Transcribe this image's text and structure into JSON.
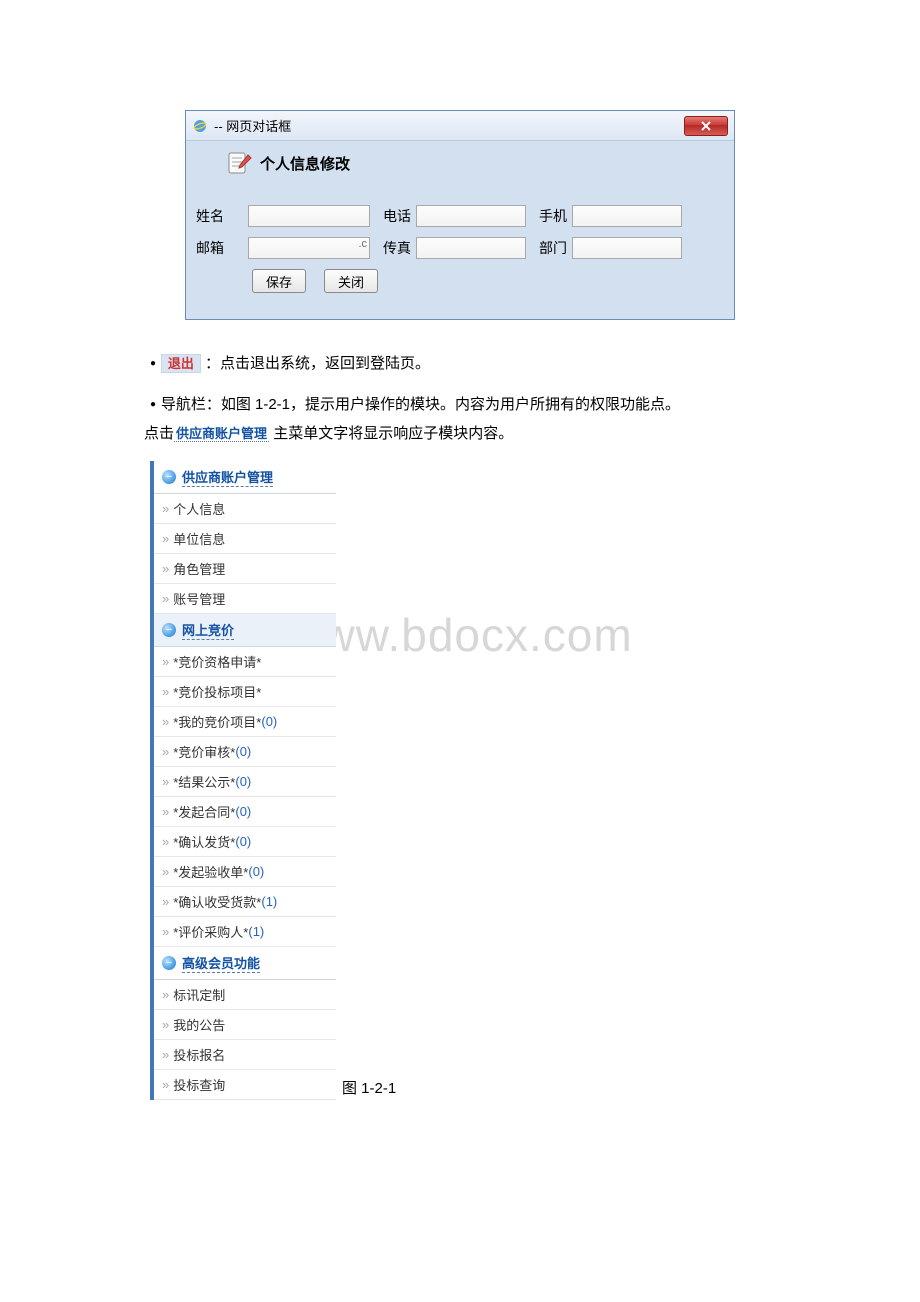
{
  "dialog": {
    "title": " -- 网页对话框",
    "section": "个人信息修改",
    "labels": {
      "name": "姓名",
      "phone": "电话",
      "mobile": "手机",
      "email": "邮箱",
      "fax": "传真",
      "dept": "部门"
    },
    "buttons": {
      "save": "保存",
      "close": "关闭"
    },
    "email_hint": ".c"
  },
  "text": {
    "logout_pill": "退出",
    "logout_tail": "：点击退出系统，返回到登陆页。",
    "nav_line1": "导航栏：如图 1-2-1，提示用户操作的模块。内容为用户所拥有的权限功能点。",
    "nav_line2_pre": "点击",
    "nav_line2_pill": "供应商账户管理",
    "nav_line2_post": " 主菜单文字将显示响应子模块内容。"
  },
  "sidebar": {
    "groups": [
      {
        "title": "供应商账户管理",
        "items": [
          {
            "label": "个人信息"
          },
          {
            "label": "单位信息"
          },
          {
            "label": "角色管理"
          },
          {
            "label": "账号管理"
          }
        ]
      },
      {
        "title": "网上竞价",
        "items": [
          {
            "label": "*竞价资格申请*"
          },
          {
            "label": "*竞价投标项目*"
          },
          {
            "label": "*我的竞价项目*",
            "count": "(0)"
          },
          {
            "label": "*竞价审核*",
            "count": "(0)"
          },
          {
            "label": "*结果公示*",
            "count": "(0)"
          },
          {
            "label": "*发起合同*",
            "count": "(0)"
          },
          {
            "label": "*确认发货*",
            "count": "(0)"
          },
          {
            "label": "*发起验收单*",
            "count": "(0)"
          },
          {
            "label": "*确认收受货款*",
            "count": "(1)"
          },
          {
            "label": "*评价采购人*",
            "count": "(1)"
          }
        ]
      },
      {
        "title": "高级会员功能",
        "items": [
          {
            "label": "标讯定制"
          },
          {
            "label": "我的公告"
          },
          {
            "label": "投标报名"
          },
          {
            "label": "投标查询"
          }
        ]
      }
    ]
  },
  "caption": "图 1-2-1",
  "watermark": "www.bdocx.com"
}
